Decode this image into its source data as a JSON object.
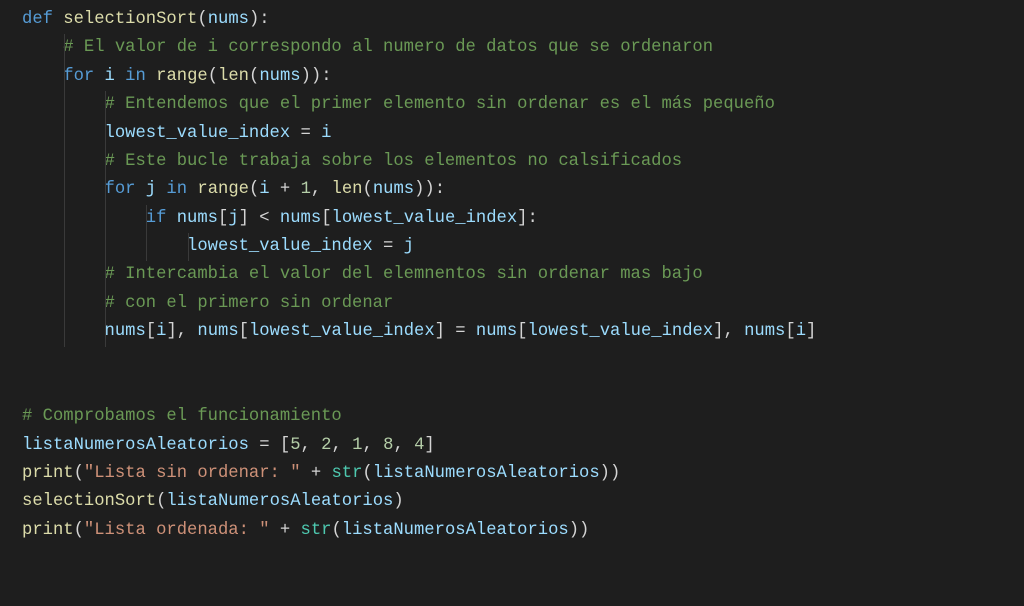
{
  "colors": {
    "background": "#1e1e1e",
    "text": "#d4d4d4",
    "keyword": "#569cd6",
    "function": "#dcdcaa",
    "variable": "#9cdcfe",
    "comment": "#6a9955",
    "string": "#ce9178",
    "number": "#b5cea8",
    "builtin": "#4ec9b0",
    "indent_guide": "#3a3a3a"
  },
  "code": {
    "lines": [
      {
        "indent": 0,
        "tokens": [
          {
            "t": "kw",
            "v": "def "
          },
          {
            "t": "fn",
            "v": "selectionSort"
          },
          {
            "t": "punc",
            "v": "("
          },
          {
            "t": "var",
            "v": "nums"
          },
          {
            "t": "punc",
            "v": "):"
          }
        ]
      },
      {
        "indent": 4,
        "tokens": [
          {
            "t": "cmt",
            "v": "# El valor de i correspondo al numero de datos que se ordenaron"
          }
        ]
      },
      {
        "indent": 4,
        "tokens": [
          {
            "t": "kw",
            "v": "for "
          },
          {
            "t": "var",
            "v": "i"
          },
          {
            "t": "kw",
            "v": " in "
          },
          {
            "t": "fn",
            "v": "range"
          },
          {
            "t": "punc",
            "v": "("
          },
          {
            "t": "fn",
            "v": "len"
          },
          {
            "t": "punc",
            "v": "("
          },
          {
            "t": "var",
            "v": "nums"
          },
          {
            "t": "punc",
            "v": ")):"
          }
        ]
      },
      {
        "indent": 8,
        "tokens": [
          {
            "t": "cmt",
            "v": "# Entendemos que el primer elemento sin ordenar es el más pequeño"
          }
        ]
      },
      {
        "indent": 8,
        "tokens": [
          {
            "t": "var",
            "v": "lowest_value_index"
          },
          {
            "t": "op",
            "v": " = "
          },
          {
            "t": "var",
            "v": "i"
          }
        ]
      },
      {
        "indent": 8,
        "tokens": [
          {
            "t": "cmt",
            "v": "# Este bucle trabaja sobre los elementos no calsificados"
          }
        ]
      },
      {
        "indent": 8,
        "tokens": [
          {
            "t": "kw",
            "v": "for "
          },
          {
            "t": "var",
            "v": "j"
          },
          {
            "t": "kw",
            "v": " in "
          },
          {
            "t": "fn",
            "v": "range"
          },
          {
            "t": "punc",
            "v": "("
          },
          {
            "t": "var",
            "v": "i"
          },
          {
            "t": "op",
            "v": " + "
          },
          {
            "t": "num",
            "v": "1"
          },
          {
            "t": "punc",
            "v": ", "
          },
          {
            "t": "fn",
            "v": "len"
          },
          {
            "t": "punc",
            "v": "("
          },
          {
            "t": "var",
            "v": "nums"
          },
          {
            "t": "punc",
            "v": ")):"
          }
        ]
      },
      {
        "indent": 12,
        "tokens": [
          {
            "t": "kw",
            "v": "if "
          },
          {
            "t": "var",
            "v": "nums"
          },
          {
            "t": "punc",
            "v": "["
          },
          {
            "t": "var",
            "v": "j"
          },
          {
            "t": "punc",
            "v": "] < "
          },
          {
            "t": "var",
            "v": "nums"
          },
          {
            "t": "punc",
            "v": "["
          },
          {
            "t": "var",
            "v": "lowest_value_index"
          },
          {
            "t": "punc",
            "v": "]:"
          }
        ]
      },
      {
        "indent": 16,
        "tokens": [
          {
            "t": "var",
            "v": "lowest_value_index"
          },
          {
            "t": "op",
            "v": " = "
          },
          {
            "t": "var",
            "v": "j"
          }
        ]
      },
      {
        "indent": 8,
        "tokens": [
          {
            "t": "cmt",
            "v": "# Intercambia el valor del elemnentos sin ordenar mas bajo"
          }
        ]
      },
      {
        "indent": 8,
        "tokens": [
          {
            "t": "cmt",
            "v": "# con el primero sin ordenar"
          }
        ]
      },
      {
        "indent": 8,
        "tokens": [
          {
            "t": "var",
            "v": "nums"
          },
          {
            "t": "punc",
            "v": "["
          },
          {
            "t": "var",
            "v": "i"
          },
          {
            "t": "punc",
            "v": "], "
          },
          {
            "t": "var",
            "v": "nums"
          },
          {
            "t": "punc",
            "v": "["
          },
          {
            "t": "var",
            "v": "lowest_value_index"
          },
          {
            "t": "punc",
            "v": "] = "
          },
          {
            "t": "var",
            "v": "nums"
          },
          {
            "t": "punc",
            "v": "["
          },
          {
            "t": "var",
            "v": "lowest_value_index"
          },
          {
            "t": "punc",
            "v": "], "
          },
          {
            "t": "var",
            "v": "nums"
          },
          {
            "t": "punc",
            "v": "["
          },
          {
            "t": "var",
            "v": "i"
          },
          {
            "t": "punc",
            "v": "]"
          }
        ]
      },
      {
        "indent": 0,
        "tokens": []
      },
      {
        "indent": 0,
        "tokens": []
      },
      {
        "indent": 0,
        "tokens": [
          {
            "t": "cmt",
            "v": "# Comprobamos el funcionamiento"
          }
        ]
      },
      {
        "indent": 0,
        "tokens": [
          {
            "t": "var",
            "v": "listaNumerosAleatorios"
          },
          {
            "t": "op",
            "v": " = "
          },
          {
            "t": "punc",
            "v": "["
          },
          {
            "t": "num",
            "v": "5"
          },
          {
            "t": "punc",
            "v": ", "
          },
          {
            "t": "num",
            "v": "2"
          },
          {
            "t": "punc",
            "v": ", "
          },
          {
            "t": "num",
            "v": "1"
          },
          {
            "t": "punc",
            "v": ", "
          },
          {
            "t": "num",
            "v": "8"
          },
          {
            "t": "punc",
            "v": ", "
          },
          {
            "t": "num",
            "v": "4"
          },
          {
            "t": "punc",
            "v": "]"
          }
        ]
      },
      {
        "indent": 0,
        "tokens": [
          {
            "t": "fn",
            "v": "print"
          },
          {
            "t": "punc",
            "v": "("
          },
          {
            "t": "str",
            "v": "\"Lista sin ordenar: \""
          },
          {
            "t": "op",
            "v": " + "
          },
          {
            "t": "builtin",
            "v": "str"
          },
          {
            "t": "punc",
            "v": "("
          },
          {
            "t": "var",
            "v": "listaNumerosAleatorios"
          },
          {
            "t": "punc",
            "v": "))"
          }
        ]
      },
      {
        "indent": 0,
        "tokens": [
          {
            "t": "fn",
            "v": "selectionSort"
          },
          {
            "t": "punc",
            "v": "("
          },
          {
            "t": "var",
            "v": "listaNumerosAleatorios"
          },
          {
            "t": "punc",
            "v": ")"
          }
        ]
      },
      {
        "indent": 0,
        "tokens": [
          {
            "t": "fn",
            "v": "print"
          },
          {
            "t": "punc",
            "v": "("
          },
          {
            "t": "str",
            "v": "\"Lista ordenada: \""
          },
          {
            "t": "op",
            "v": " + "
          },
          {
            "t": "builtin",
            "v": "str"
          },
          {
            "t": "punc",
            "v": "("
          },
          {
            "t": "var",
            "v": "listaNumerosAleatorios"
          },
          {
            "t": "punc",
            "v": "))"
          }
        ]
      }
    ]
  }
}
